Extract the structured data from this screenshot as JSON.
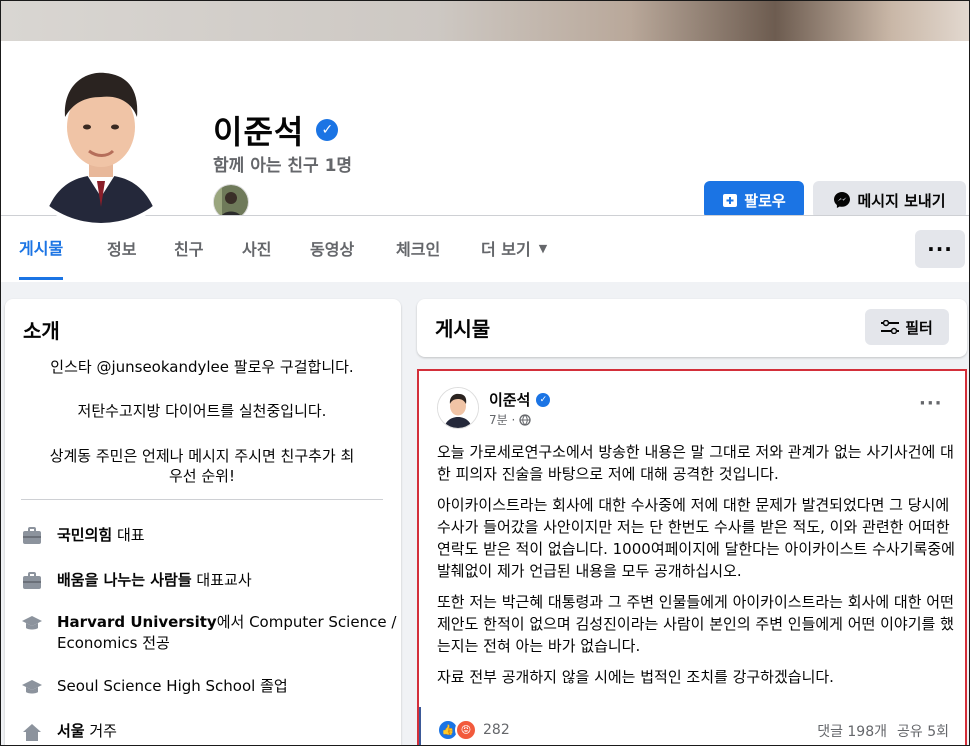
{
  "profile": {
    "name": "이준석",
    "mutual_friends": "함께 아는 친구 1명",
    "follow_label": "팔로우",
    "message_label": "메시지 보내기"
  },
  "tabs": [
    {
      "label": "게시물"
    },
    {
      "label": "정보"
    },
    {
      "label": "친구"
    },
    {
      "label": "사진"
    },
    {
      "label": "동영상"
    },
    {
      "label": "체크인"
    },
    {
      "label": "더 보기"
    }
  ],
  "more_dots": "···",
  "intro": {
    "title": "소개",
    "bio": [
      "인스타 @junseokandylee 팔로우 구걸합니다.",
      "저탄수고지방 다이어트를 실천중입니다.",
      "상계동 주민은 언제나 메시지 주시면 친구추가 최",
      "우선 순위!"
    ],
    "items": [
      {
        "bold": "국민의힘",
        "text": " 대표"
      },
      {
        "bold": "배움을 나누는 사람들",
        "text": " 대표교사"
      },
      {
        "bold": "Harvard University",
        "text": "에서 Computer Science /",
        "text2": "Economics 전공"
      },
      {
        "bold": "",
        "text": "Seoul Science High School 졸업"
      },
      {
        "bold": "서울",
        "text": " 거주"
      }
    ]
  },
  "posts_header": {
    "title": "게시물",
    "filter_label": "필터"
  },
  "post": {
    "author": "이준석",
    "time": "7분 ·",
    "dots": "···",
    "paragraphs": [
      "오늘 가로세로연구소에서 방송한 내용은 말 그대로 저와 관계가 없는 사기사건에 대한 피의자 진술을 바탕으로 저에 대해 공격한 것입니다.",
      "아이카이스트라는 회사에 대한 수사중에 저에 대한 문제가 발견되었다면 그 당시에 수사가 들어갔을 사안이지만 저는 단 한번도 수사를 받은 적도, 이와 관련한 어떠한 연락도 받은 적이 없습니다. 1000여페이지에 달한다는 아이카이스트 수사기록중에 발췌없이 제가 언급된 내용을 모두 공개하십시오.",
      "또한 저는 박근혜 대통령과 그 주변 인물들에게 아이카이스트라는 회사에 대한 어떤 제안도 한적이 없으며 김성진이라는 사람이 본인의 주변 인들에게 어떤 이야기를 했는지는 전혀 아는 바가 없습니다.",
      "자료 전부 공개하지 않을 시에는 법적인 조치를 강구하겠습니다."
    ],
    "reaction_count": "282",
    "comments": "댓글 198개",
    "shares": "공유 5회"
  },
  "colors": {
    "accent": "#1b74e4",
    "highlight_border": "#d32f3a"
  }
}
